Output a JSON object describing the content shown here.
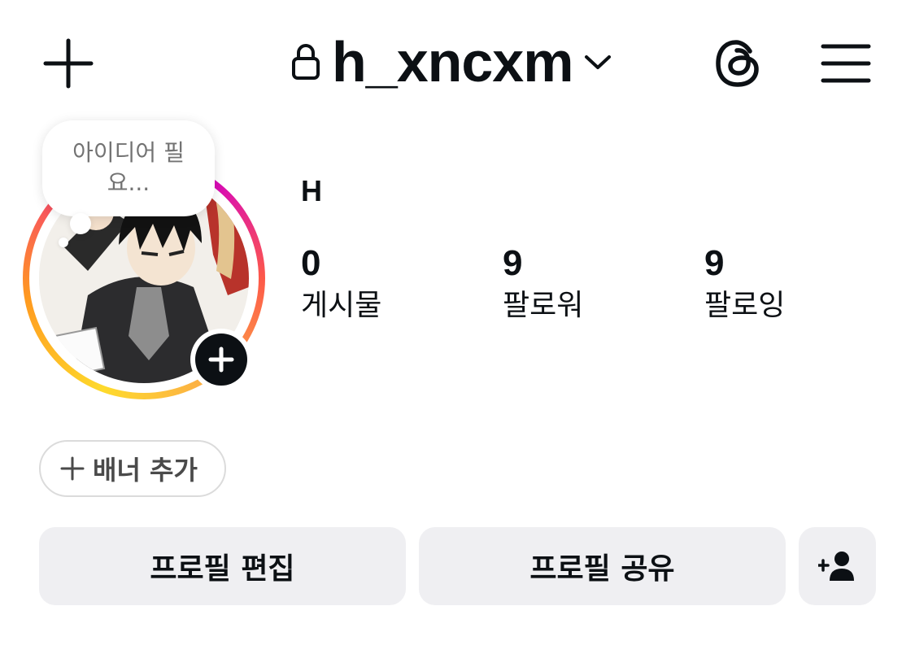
{
  "header": {
    "username": "h_xncxm"
  },
  "note": {
    "text_line1": "아이디어 필",
    "text_line2": "요..."
  },
  "profile": {
    "display_name": "H",
    "stats": [
      {
        "count": "0",
        "label": "게시물"
      },
      {
        "count": "9",
        "label": "팔로워"
      },
      {
        "count": "9",
        "label": "팔로잉"
      }
    ]
  },
  "banner": {
    "label": "배너 추가"
  },
  "actions": {
    "edit_label": "프로필 편집",
    "share_label": "프로필 공유"
  },
  "colors": {
    "text": "#0c1014",
    "button_bg": "#efeff2",
    "note_text": "#737373",
    "ring_start": "#feda2c",
    "ring_end": "#d300c5"
  },
  "icons": [
    "plus-icon",
    "lock-icon",
    "chevron-down-icon",
    "threads-icon",
    "hamburger-menu-icon",
    "add-story-icon",
    "add-person-icon"
  ]
}
